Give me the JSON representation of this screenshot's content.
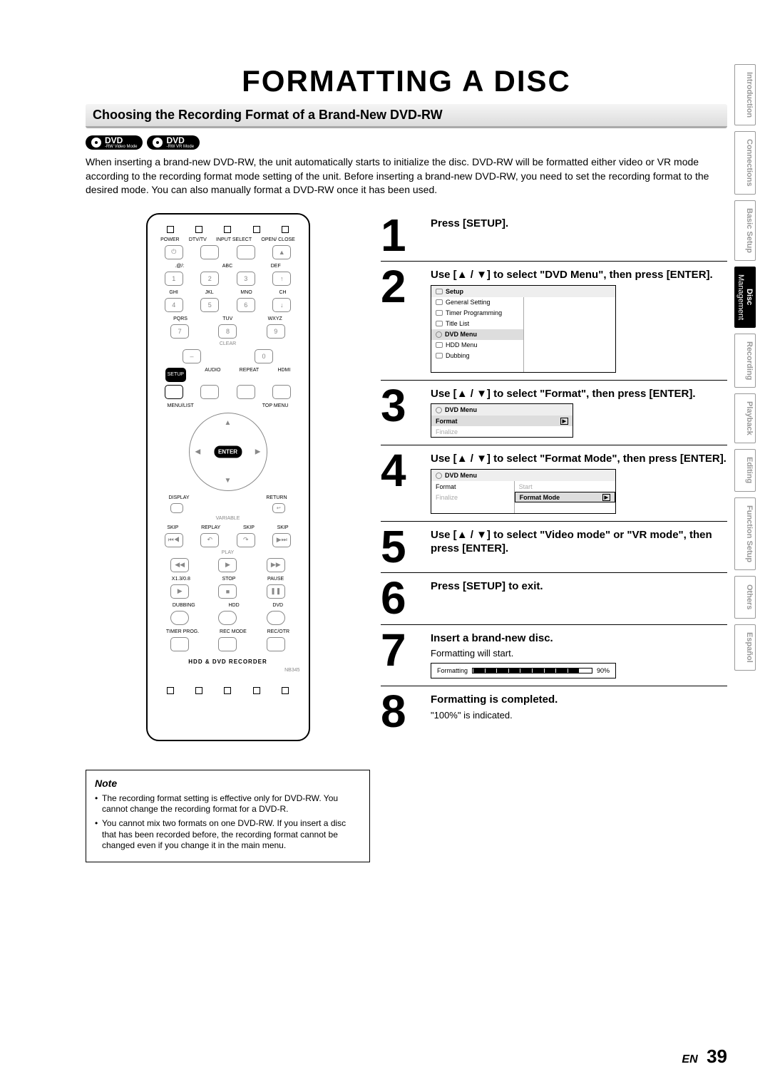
{
  "title": "FORMATTING A DISC",
  "section_header": "Choosing the Recording Format of a Brand-New DVD-RW",
  "badges": [
    {
      "big": "DVD",
      "small1": "-RW",
      "small2": "Video Mode"
    },
    {
      "big": "DVD",
      "small1": "-RW",
      "small2": "VR Mode"
    }
  ],
  "intro": "When inserting a brand-new DVD-RW, the unit automatically starts to initialize the disc. DVD-RW will be formatted either video or VR mode according to the recording format mode setting of the unit. Before inserting a brand-new DVD-RW, you need to set the recording format to the desired mode. You can also manually format a DVD-RW once it has been used.",
  "remote": {
    "row_labels_1": [
      "POWER",
      "DTV/TV",
      "INPUT SELECT",
      "OPEN/ CLOSE"
    ],
    "row_labels_2": [
      ".@/:",
      "ABC",
      "DEF"
    ],
    "row_labels_3": [
      "GHI",
      "JKL",
      "MNO",
      "CH"
    ],
    "row_labels_4": [
      "PQRS",
      "TUV",
      "WXYZ"
    ],
    "clear": "CLEAR",
    "row_labels_5": [
      "SETUP",
      "AUDIO",
      "REPEAT",
      "HDMI"
    ],
    "menu_list": "MENU/LIST",
    "top_menu": "TOP MENU",
    "enter": "ENTER",
    "display": "DISPLAY",
    "return": "RETURN",
    "variable": "VARIABLE",
    "skip_replay": [
      "SKIP",
      "REPLAY",
      "SKIP",
      "SKIP"
    ],
    "play": "PLAY",
    "speed": "X1.3/0.8",
    "stop": "STOP",
    "pause": "PAUSE",
    "dubbing": "DUBBING",
    "hdd": "HDD",
    "dvd": "DVD",
    "timer": "TIMER PROG.",
    "recmode": "REC MODE",
    "recotr": "REC/OTR",
    "footer": "HDD & DVD RECORDER",
    "model": "NB345"
  },
  "note": {
    "title": "Note",
    "items": [
      "The recording format setting is effective only for DVD-RW. You cannot change the recording format for a DVD-R.",
      "You cannot mix two formats on one DVD-RW. If you insert a disc that has been recorded before, the recording format cannot be changed even if you change it in the main menu."
    ]
  },
  "steps": {
    "s1": {
      "num": "1",
      "title": "Press [SETUP]."
    },
    "s2": {
      "num": "2",
      "title_pre": "Use [",
      "title_mid": " / ",
      "title_post": "] to select \"DVD Menu\", then press [ENTER].",
      "osd": {
        "title": "Setup",
        "items": [
          "General Setting",
          "Timer Programming",
          "Title List",
          "DVD Menu",
          "HDD Menu",
          "Dubbing"
        ],
        "hl_index": 3
      }
    },
    "s3": {
      "num": "3",
      "title_pre": "Use [",
      "title_mid": " / ",
      "title_post": "] to select \"Format\", then press [ENTER].",
      "osd": {
        "title": "DVD Menu",
        "items": [
          "Format",
          "Finalize"
        ],
        "hl_index": 0
      }
    },
    "s4": {
      "num": "4",
      "title_pre": "Use [",
      "title_mid": " / ",
      "title_post": "] to select \"Format Mode\", then press [ENTER].",
      "osd": {
        "title": "DVD Menu",
        "left": [
          "Format",
          "Finalize"
        ],
        "right_faded": "Start",
        "right_hl": "Format Mode"
      }
    },
    "s5": {
      "num": "5",
      "title_pre": "Use [",
      "title_mid": " / ",
      "title_post": "] to select \"Video mode\" or \"VR mode\", then press [ENTER]."
    },
    "s6": {
      "num": "6",
      "title": "Press [SETUP] to exit."
    },
    "s7": {
      "num": "7",
      "title": "Insert a brand-new disc.",
      "sub": "Formatting will start.",
      "progress": {
        "label": "Formatting",
        "pct": "90%"
      }
    },
    "s8": {
      "num": "8",
      "title": "Formatting is completed.",
      "sub": "\"100%\" is indicated."
    }
  },
  "side_tabs": [
    {
      "label": "Introduction",
      "active": false
    },
    {
      "label": "Connections",
      "active": false
    },
    {
      "label": "Basic Setup",
      "active": false
    },
    {
      "label": "Disc",
      "sub": "Management",
      "active": true
    },
    {
      "label": "Recording",
      "active": false
    },
    {
      "label": "Playback",
      "active": false
    },
    {
      "label": "Editing",
      "active": false
    },
    {
      "label": "Function Setup",
      "active": false
    },
    {
      "label": "Others",
      "active": false
    },
    {
      "label": "Español",
      "active": false
    }
  ],
  "footer": {
    "lang": "EN",
    "page": "39"
  }
}
